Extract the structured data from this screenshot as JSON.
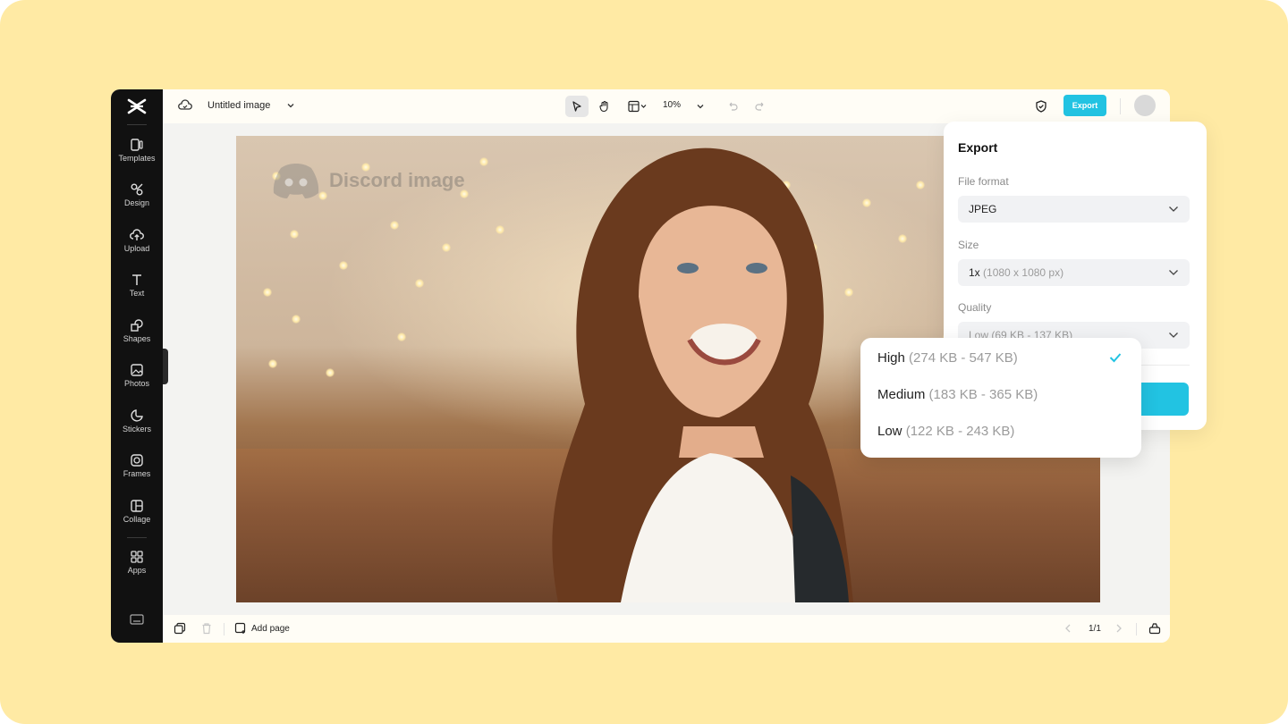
{
  "sidebar": {
    "items": [
      {
        "label": "Templates",
        "icon": "templates-icon"
      },
      {
        "label": "Design",
        "icon": "design-icon"
      },
      {
        "label": "Upload",
        "icon": "upload-icon"
      },
      {
        "label": "Text",
        "icon": "text-icon"
      },
      {
        "label": "Shapes",
        "icon": "shapes-icon"
      },
      {
        "label": "Photos",
        "icon": "photos-icon"
      },
      {
        "label": "Stickers",
        "icon": "stickers-icon"
      },
      {
        "label": "Frames",
        "icon": "frames-icon"
      },
      {
        "label": "Collage",
        "icon": "collage-icon"
      },
      {
        "label": "Apps",
        "icon": "apps-icon"
      }
    ]
  },
  "topbar": {
    "doc_title": "Untitled image",
    "zoom": "10%",
    "export_label": "Export"
  },
  "canvas": {
    "watermark_text": "Discord image"
  },
  "bottombar": {
    "add_page_label": "Add page",
    "page_indicator": "1/1"
  },
  "export_panel": {
    "title": "Export",
    "file_format_label": "File format",
    "file_format_value": "JPEG",
    "size_label": "Size",
    "size_value": "1x",
    "size_detail": "(1080 x 1080 px)",
    "quality_label": "Quality",
    "quality_value": "Low",
    "quality_detail": "(69 KB - 137 KB)"
  },
  "quality_dropdown": {
    "options": [
      {
        "name": "High",
        "range": "(274 KB - 547 KB)",
        "selected": true
      },
      {
        "name": "Medium",
        "range": "(183 KB - 365 KB)",
        "selected": false
      },
      {
        "name": "Low",
        "range": "(122 KB - 243 KB)",
        "selected": false
      }
    ]
  },
  "colors": {
    "accent": "#22c3e2",
    "backdrop": "#ffeaa4",
    "sidebar": "#111111"
  }
}
